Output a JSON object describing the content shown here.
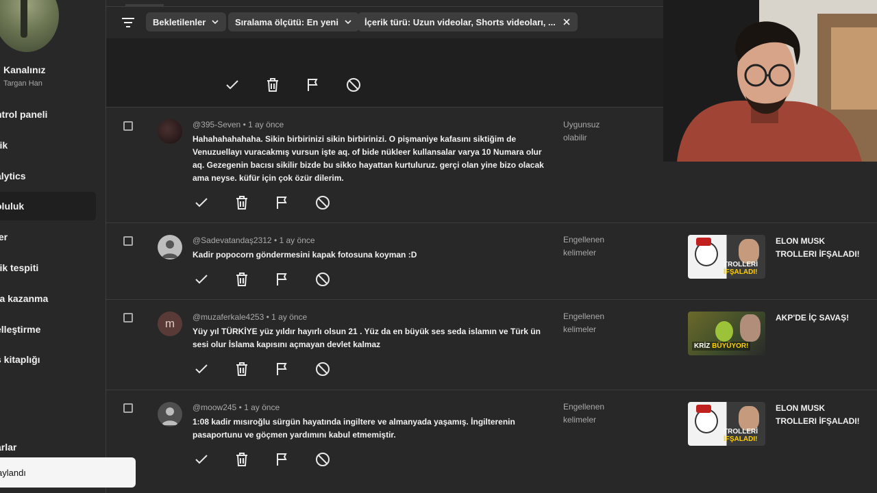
{
  "sidebar": {
    "channel_title": "Kanalınız",
    "channel_sub": "Targan Han",
    "items": [
      {
        "label": "ntrol paneli"
      },
      {
        "label": "rik"
      },
      {
        "label": "alytics"
      },
      {
        "label": "oluluk"
      },
      {
        "label": "ler"
      },
      {
        "label": "rik tespiti"
      },
      {
        "label": "ra kazanma"
      },
      {
        "label": "elleştirme"
      },
      {
        "label": "s kitaplığı"
      },
      {
        "label": "arlar"
      }
    ],
    "toast": "aylandı"
  },
  "toolbar": {
    "chip1": "Bekletilenler",
    "chip2": "Sıralama ölçütü: En yeni",
    "chip3": "İçerik türü: Uzun videolar, Shorts videoları, ..."
  },
  "icons": [
    "filter-icon",
    "chevron-down-icon",
    "close-icon",
    "check-icon",
    "trash-icon",
    "flag-icon",
    "block-icon"
  ],
  "comments": [
    {
      "author": "@395-Seven",
      "time": "1 ay önce",
      "text": "Hahahahahahaha. Sikin birbirinizi sikin birbirinizi. O pişmaniye kafasını siktiğim de Venuzuellayı vuracakmış vursun işte aq. of bide nükleer kullansalar varya 10 Numara olur aq. Gezegenin bacısı sikilir bizde bu sikko hayattan kurtuluruz. gerçi olan yine bizo olacak ama neyse. küfür için çok özür dilerim.",
      "reason": "Uygunsuz olabilir",
      "video_title": ""
    },
    {
      "author": "@Sadevatandaş2312",
      "time": "1 ay önce",
      "text": "Kadir popocorn göndermesini kapak fotosuna koyman :D",
      "reason": "Engellenen kelimeler",
      "video_title": "ELON MUSK TROLLERI İFŞALADI!",
      "thumb_text1": "TROLLERİ",
      "thumb_text2": "İFŞALADI!"
    },
    {
      "author": "@muzaferkale4253",
      "time": "1 ay önce",
      "avatar_letter": "m",
      "text": "Yüy yıl TÜRKİYE  yüz yıldır hayırlı olsun  21 . Yüz da en büyük ses seda islamın  ve Türk ün sesi olur İslama kapısını açmayan devlet kalmaz",
      "reason": "Engellenen kelimeler",
      "video_title": "AKP'DE İÇ SAVAŞ!",
      "thumb_text1": "KRİZ",
      "thumb_text2": "BÜYÜYOR!"
    },
    {
      "author": "@moow245",
      "time": "1 ay önce",
      "text": "1:08 kadir mısıroğlu sürgün hayatında ingiltere ve almanyada yaşamış. İngilterenin pasaportunu ve göçmen yardımını kabul etmemiştir.",
      "reason": "Engellenen kelimeler",
      "video_title": "ELON MUSK TROLLERI İFŞALADI!",
      "thumb_text1": "TROLLERİ",
      "thumb_text2": "İFŞALADI!"
    }
  ],
  "colors": {
    "bg": "#282828",
    "selected_bg": "#1f1f1f",
    "chip_bg": "#3d3d3d",
    "muted": "#aaaaaa"
  }
}
